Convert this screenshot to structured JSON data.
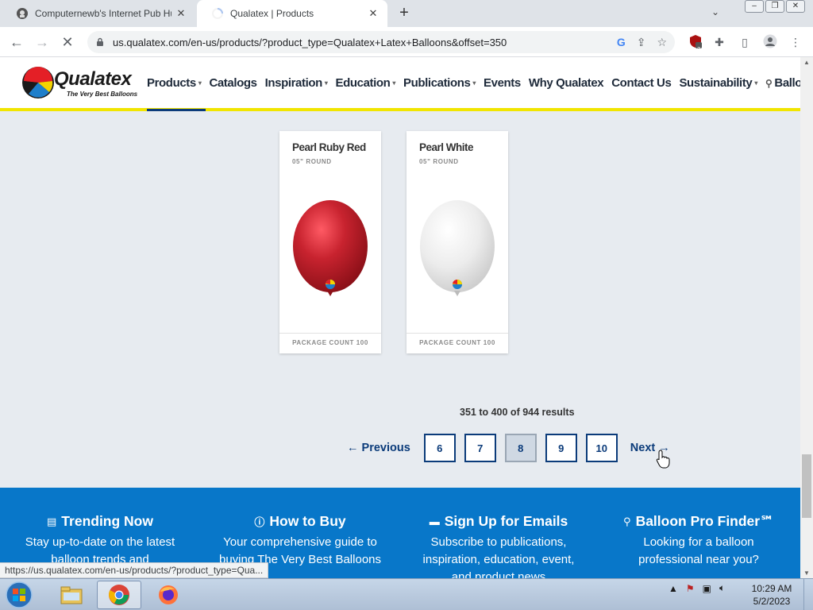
{
  "browser": {
    "tabs": [
      {
        "title": "Computernewb's Internet Pub Hub",
        "active": false
      },
      {
        "title": "Qualatex | Products",
        "active": true
      }
    ],
    "url": "us.qualatex.com/en-us/products/?product_type=Qualatex+Latex+Balloons&offset=350",
    "extension_badge": "3",
    "status_url": "https://us.qualatex.com/en-us/products/?product_type=Qua..."
  },
  "site": {
    "logo_text": "Qualatex",
    "logo_tagline": "The Very Best Balloons",
    "nav": [
      {
        "label": "Products",
        "dropdown": true
      },
      {
        "label": "Catalogs",
        "dropdown": false
      },
      {
        "label": "Inspiration",
        "dropdown": true
      },
      {
        "label": "Education",
        "dropdown": true
      },
      {
        "label": "Publications",
        "dropdown": true
      },
      {
        "label": "Events",
        "dropdown": false
      },
      {
        "label": "Why Qualatex",
        "dropdown": false
      },
      {
        "label": "Contact Us",
        "dropdown": false
      },
      {
        "label": "Sustainability",
        "dropdown": true
      },
      {
        "label": "Balloon Pro Finder",
        "dropdown": false
      }
    ]
  },
  "products": [
    {
      "name": "Pearl Ruby Red",
      "size": "05\" ROUND",
      "package": "PACKAGE COUNT 100",
      "color": "#c8232f"
    },
    {
      "name": "Pearl White",
      "size": "05\" ROUND",
      "package": "PACKAGE COUNT 100",
      "color": "#ececec"
    }
  ],
  "pagination": {
    "results_text": "351 to 400 of 944 results",
    "previous": "← Previous",
    "pages": [
      "6",
      "7",
      "8",
      "9",
      "10"
    ],
    "current": "8",
    "next": "Next →"
  },
  "footer": [
    {
      "icon": "trending-icon",
      "title": "Trending Now",
      "body": "Stay up-to-date on the latest balloon trends and"
    },
    {
      "icon": "info-icon",
      "title": "How to Buy",
      "body": "Your comprehensive guide to buying The Very Best Balloons"
    },
    {
      "icon": "email-icon",
      "title": "Sign Up for Emails",
      "body": "Subscribe to publications, inspiration, education, event, and product news"
    },
    {
      "icon": "location-pin-icon",
      "title": "Balloon Pro Finder℠",
      "body": "Looking for a balloon professional near you?"
    }
  ],
  "taskbar": {
    "time": "10:29 AM",
    "date": "5/2/2023"
  },
  "colors": {
    "brand_blue": "#0b3b7a",
    "footer_blue": "#0877c9",
    "accent_yellow": "#f1e500"
  }
}
